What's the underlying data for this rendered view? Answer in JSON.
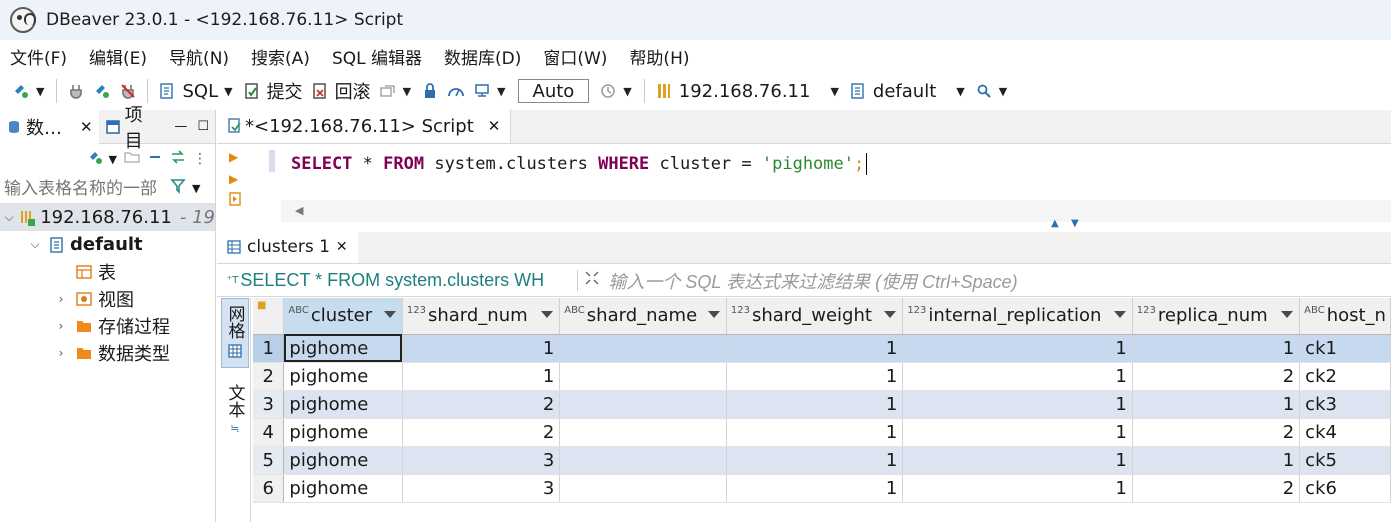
{
  "window": {
    "title": "DBeaver 23.0.1 - <192.168.76.11> Script"
  },
  "menu": [
    "文件(F)",
    "编辑(E)",
    "导航(N)",
    "搜索(A)",
    "SQL 编辑器",
    "数据库(D)",
    "窗口(W)",
    "帮助(H)"
  ],
  "toolbar": {
    "sql_label": "SQL",
    "commit_label": "提交",
    "rollback_label": "回滚",
    "tx_mode": "Auto",
    "connection": "192.168.76.11",
    "schema": "default"
  },
  "left_panel": {
    "tab_db": "数…",
    "tab_projects": "项目",
    "filter_placeholder": "输入表格名称的一部",
    "tree": {
      "connection": "192.168.76.11",
      "connection_suffix": "- 19",
      "database": "default",
      "tables": "表",
      "views": "视图",
      "procedures": "存储过程",
      "datatypes": "数据类型"
    }
  },
  "editor": {
    "tab_label": "*<192.168.76.11> Script",
    "sql": {
      "kw1": "SELECT",
      "part1": " * ",
      "kw2": "FROM",
      "part2": " system.clusters ",
      "kw3": "WHERE",
      "part3": " cluster = ",
      "str": "'pighome'",
      "tail": ";"
    }
  },
  "results": {
    "tab_label": "clusters 1",
    "filter_sql": "SELECT * FROM system.clusters WH",
    "filter_placeholder": "输入一个 SQL 表达式来过滤结果 (使用 Ctrl+Space)",
    "side_grid": "网格",
    "side_text": "文本",
    "columns": [
      {
        "name": "cluster",
        "type": "ABC"
      },
      {
        "name": "shard_num",
        "type": "123"
      },
      {
        "name": "shard_name",
        "type": "ABC"
      },
      {
        "name": "shard_weight",
        "type": "123"
      },
      {
        "name": "internal_replication",
        "type": "123"
      },
      {
        "name": "replica_num",
        "type": "123"
      },
      {
        "name": "host_n",
        "type": "ABC"
      }
    ],
    "rows": [
      [
        "1",
        "pighome",
        "1",
        "",
        "1",
        "1",
        "1",
        "ck1"
      ],
      [
        "2",
        "pighome",
        "1",
        "",
        "1",
        "1",
        "2",
        "ck2"
      ],
      [
        "3",
        "pighome",
        "2",
        "",
        "1",
        "1",
        "1",
        "ck3"
      ],
      [
        "4",
        "pighome",
        "2",
        "",
        "1",
        "1",
        "2",
        "ck4"
      ],
      [
        "5",
        "pighome",
        "3",
        "",
        "1",
        "1",
        "1",
        "ck5"
      ],
      [
        "6",
        "pighome",
        "3",
        "",
        "1",
        "1",
        "2",
        "ck6"
      ]
    ]
  }
}
